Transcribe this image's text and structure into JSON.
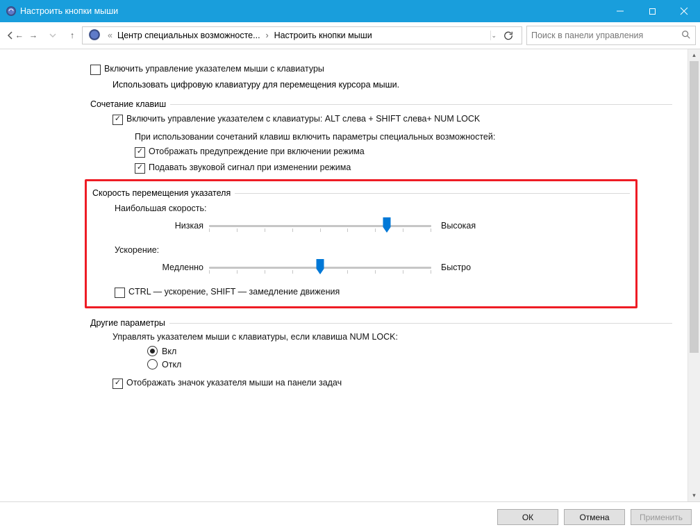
{
  "window": {
    "title": "Настроить кнопки мыши"
  },
  "breadcrumb": {
    "crumb1": "Центр специальных возможносте...",
    "crumb2": "Настроить кнопки мыши"
  },
  "search": {
    "placeholder": "Поиск в панели управления"
  },
  "main": {
    "chk_enable": "Включить управление указателем мыши с клавиатуры",
    "desc": "Использовать цифровую клавиатуру для перемещения курсора мыши.",
    "legend_hotkeys": "Сочетание клавиш",
    "chk_hotkey": "Включить управление указателем с клавиатуры: ALT слева + SHIFT слева+ NUM LOCK",
    "hotkey_desc": "При использовании сочетаний клавиш включить параметры специальных возможностей:",
    "chk_warn": "Отображать предупреждение при включении режима",
    "chk_sound": "Подавать звуковой сигнал при изменении режима",
    "legend_speed": "Скорость перемещения указателя",
    "lbl_topspeed": "Наибольшая скорость:",
    "sld_low": "Низкая",
    "sld_high": "Высокая",
    "lbl_accel": "Ускорение:",
    "sld_slow": "Медленно",
    "sld_fast": "Быстро",
    "chk_ctrl": "CTRL — ускорение, SHIFT — замедление движения",
    "legend_other": "Другие параметры",
    "numlock_label": "Управлять указателем мыши с клавиатуры, если клавиша NUM LOCK:",
    "radio_on": "Вкл",
    "radio_off": "Откл",
    "chk_tray": "Отображать значок указателя мыши на панели задач"
  },
  "footer": {
    "ok": "ОК",
    "cancel": "Отмена",
    "apply": "Применить"
  }
}
